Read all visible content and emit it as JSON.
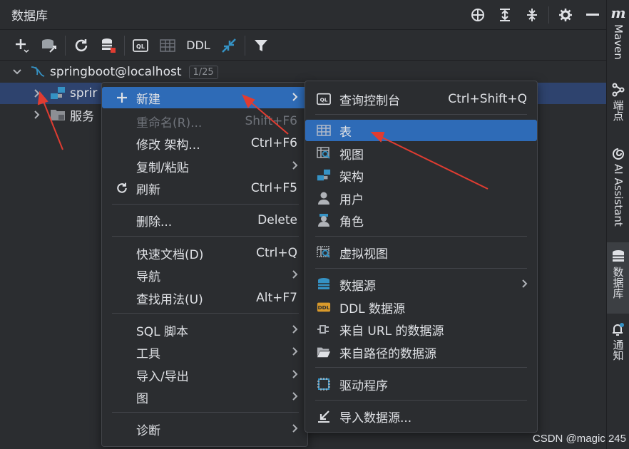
{
  "header": {
    "title": "数据库"
  },
  "toolbar": {
    "ddl_label": "DDL"
  },
  "tree": {
    "root": {
      "label": "springboot@localhost",
      "badge": "1/25"
    },
    "schema": {
      "label": "sprir"
    },
    "server": {
      "label": "服务"
    }
  },
  "stripe": {
    "maven": "Maven",
    "endpoints": "端点",
    "ai": "AI Assistant",
    "database": "数据库",
    "notifications": "通知"
  },
  "context_menu": {
    "items": [
      {
        "label": "新建"
      },
      {
        "label": "重命名(R)...",
        "shortcut": "Shift+F6"
      },
      {
        "label": "修改 架构...",
        "shortcut": "Ctrl+F6"
      },
      {
        "label": "复制/粘贴"
      },
      {
        "label": "刷新",
        "shortcut": "Ctrl+F5"
      },
      {
        "label": "删除...",
        "shortcut": "Delete"
      },
      {
        "label": "快速文档(D)",
        "shortcut": "Ctrl+Q"
      },
      {
        "label": "导航"
      },
      {
        "label": "查找用法(U)",
        "shortcut": "Alt+F7"
      },
      {
        "label": "SQL 脚本"
      },
      {
        "label": "工具"
      },
      {
        "label": "导入/导出"
      },
      {
        "label": "图"
      },
      {
        "label": "诊断"
      }
    ]
  },
  "submenu": {
    "items": [
      {
        "label": "查询控制台",
        "shortcut": "Ctrl+Shift+Q"
      },
      {
        "label": "表"
      },
      {
        "label": "视图"
      },
      {
        "label": "架构"
      },
      {
        "label": "用户"
      },
      {
        "label": "角色"
      },
      {
        "label": "虚拟视图"
      },
      {
        "label": "数据源"
      },
      {
        "label": "DDL 数据源"
      },
      {
        "label": "来自 URL 的数据源"
      },
      {
        "label": "来自路径的数据源"
      },
      {
        "label": "驱动程序"
      },
      {
        "label": "导入数据源..."
      }
    ]
  },
  "watermark": "CSDN @magic 245",
  "colors": {
    "background": "#2b2d30",
    "selection": "#2e436e",
    "highlight": "#2e6bb7",
    "annotation": "#e03c31"
  }
}
